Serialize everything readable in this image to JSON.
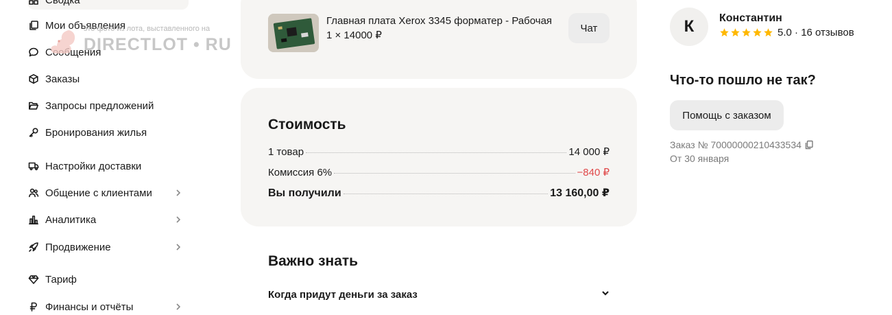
{
  "sidebar": {
    "items": [
      {
        "label": "Сводка",
        "icon": "grid-icon"
      },
      {
        "label": "Мои объявления",
        "icon": "copy-icon"
      },
      {
        "label": "Сообщения",
        "icon": "chat-bubble-icon"
      },
      {
        "label": "Заказы",
        "icon": "box-icon"
      },
      {
        "label": "Запросы предложений",
        "icon": "folder-open-icon"
      },
      {
        "label": "Бронирования жилья",
        "icon": "key-icon"
      },
      {
        "label": "Настройки доставки",
        "icon": "truck-icon"
      },
      {
        "label": "Общение с клиентами",
        "icon": "users-icon"
      },
      {
        "label": "Аналитика",
        "icon": "bar-chart-icon"
      },
      {
        "label": "Продвижение",
        "icon": "rocket-icon"
      },
      {
        "label": "Тариф",
        "icon": "diamond-icon"
      },
      {
        "label": "Финансы и отчёты",
        "icon": "ruble-icon"
      }
    ]
  },
  "watermark": {
    "caption": "это фото из лота, выставленного на",
    "logo": "DIRECTLOT • RU"
  },
  "product": {
    "title": "Главная плата Xerox 3345 форматер - Рабочая",
    "qty_price": "1 × 14000 ₽",
    "chat_label": "Чат"
  },
  "cost": {
    "title": "Стоимость",
    "rows": [
      {
        "label": "1 товар",
        "value": "14 000 ₽"
      },
      {
        "label": "Комиссия 6%",
        "value": "−840 ₽"
      },
      {
        "label": "Вы получили",
        "value": "13 160,00 ₽"
      }
    ]
  },
  "important": {
    "title": "Важно знать",
    "faq": [
      {
        "label": "Когда придут деньги за заказ"
      }
    ]
  },
  "seller": {
    "initial": "К",
    "name": "Константин",
    "rating": "5.0",
    "reviews": "· 16 отзывов",
    "stars": 5,
    "star_color": "#ffb800"
  },
  "support": {
    "title": "Что-то пошло не так?",
    "help_label": "Помощь с заказом",
    "order_number": "Заказ № 70000000210433534",
    "order_date": "От 30 января"
  },
  "colors": {
    "card_bg": "#f6f5f3",
    "button_bg": "#ececec",
    "negative": "#e0494a",
    "muted": "#7a7a7a"
  }
}
